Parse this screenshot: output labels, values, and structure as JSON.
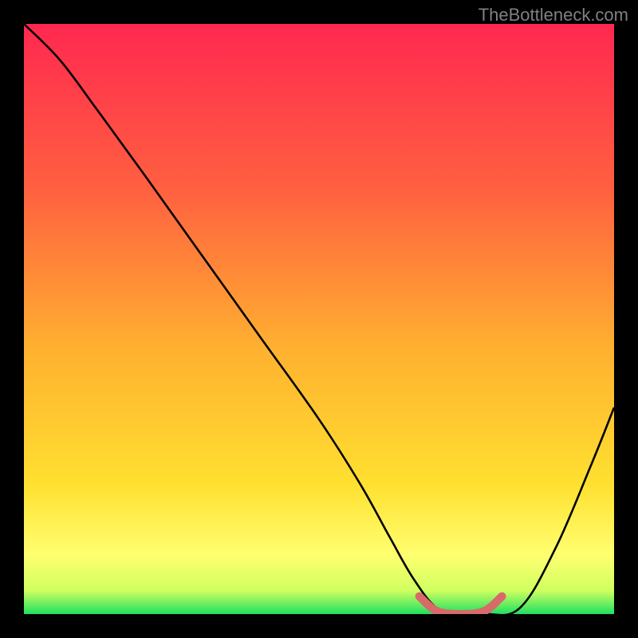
{
  "watermark": "TheBottleneck.com",
  "chart_data": {
    "type": "line",
    "title": "",
    "xlabel": "",
    "ylabel": "",
    "xlim": [
      0,
      100
    ],
    "ylim": [
      0,
      100
    ],
    "grid": false,
    "legend": false,
    "background_gradient": {
      "top": "#ff2850",
      "mid_upper": "#ff8040",
      "mid": "#ffd030",
      "mid_lower": "#ffff60",
      "bottom": "#20e060"
    },
    "series": [
      {
        "name": "bottleneck-curve",
        "color": "#000000",
        "x": [
          0,
          6,
          12,
          20,
          30,
          40,
          50,
          57,
          62,
          66,
          70,
          74,
          78,
          84,
          90,
          96,
          100
        ],
        "y": [
          100,
          94,
          86,
          75,
          61,
          47,
          33,
          22,
          13,
          6,
          1,
          0,
          0,
          1,
          11,
          25,
          35
        ]
      },
      {
        "name": "optimal-range-marker",
        "color": "#d86a6a",
        "x": [
          67,
          70,
          74,
          78,
          81
        ],
        "y": [
          3,
          0.5,
          0,
          0.5,
          3
        ]
      }
    ],
    "annotations": []
  }
}
